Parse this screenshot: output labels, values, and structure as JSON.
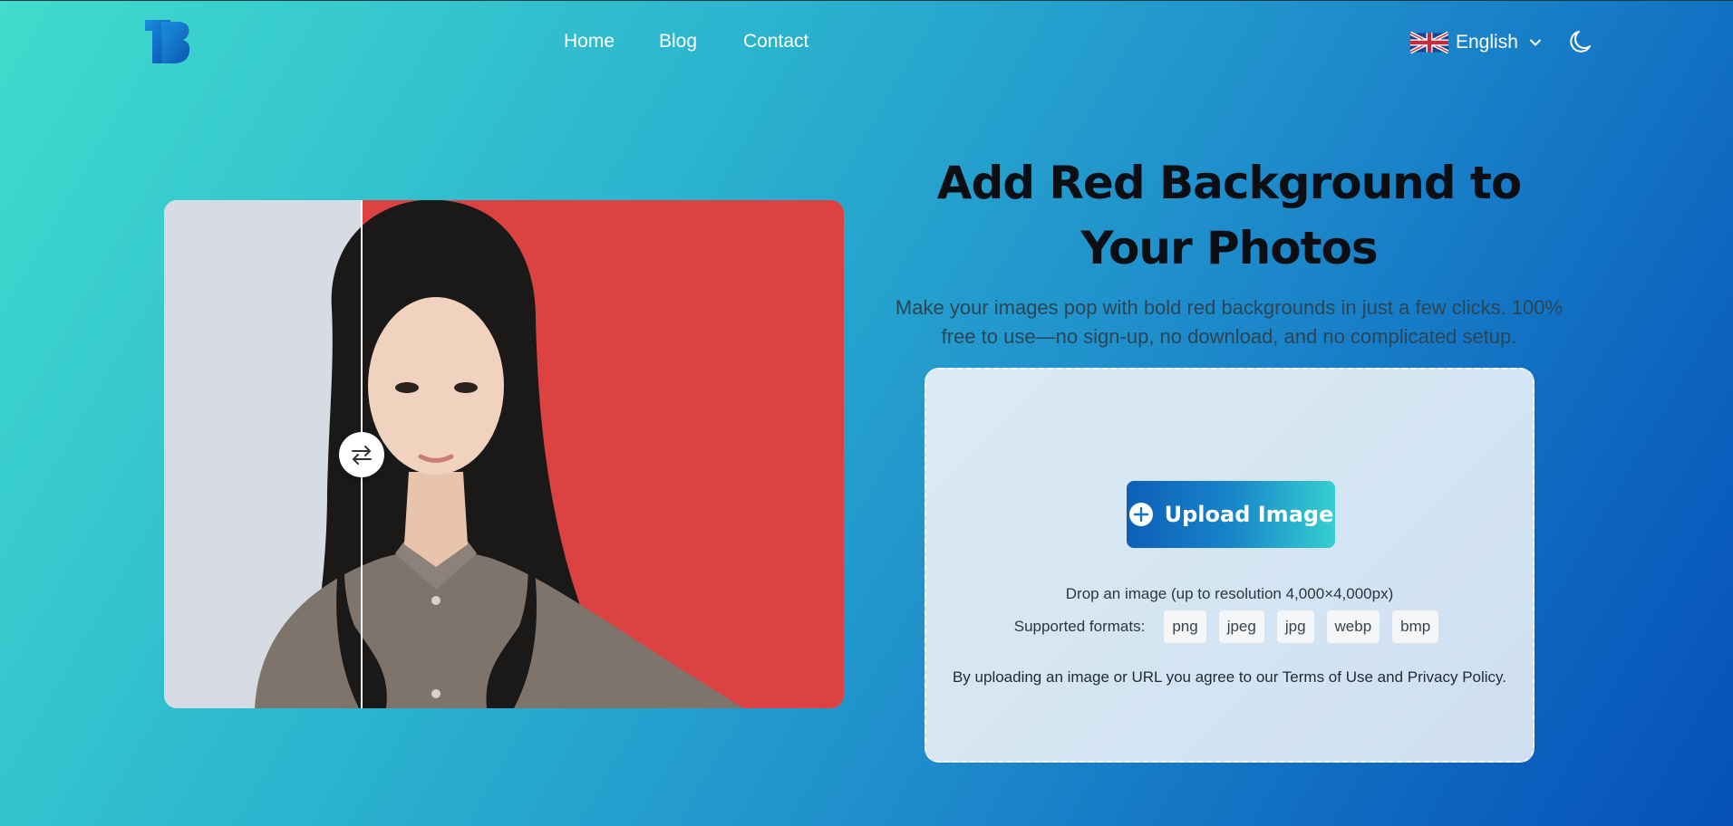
{
  "nav": {
    "items": [
      {
        "label": "Home"
      },
      {
        "label": "Blog"
      },
      {
        "label": "Contact"
      }
    ],
    "language": "English",
    "logo_icon": "tb-logo-icon",
    "theme_icon": "moon-icon"
  },
  "hero": {
    "title": "Add Red Background to Your Photos",
    "subtitle": "Make your images pop with bold red backgrounds in just a few clicks. 100% free to use—no sign-up, no download, and no complicated setup."
  },
  "compare": {
    "before_color": "#d7dbe4",
    "after_color": "#db4241",
    "handle_icon": "swap-arrows-icon"
  },
  "upload": {
    "button_label": "Upload Image",
    "button_icon": "plus-circle-icon",
    "drop_text": "Drop an image (up to resolution 4,000×4,000px)",
    "formats_label": "Supported formats:",
    "formats": [
      "png",
      "jpeg",
      "jpg",
      "webp",
      "bmp"
    ],
    "terms": "By uploading an image or URL you agree to our Terms of Use and Privacy Policy."
  },
  "colors": {
    "accent": "#0d5fb8",
    "accent_end": "#36cfd0"
  }
}
